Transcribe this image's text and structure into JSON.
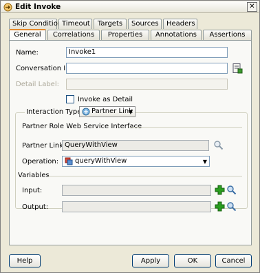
{
  "window": {
    "title": "Edit Invoke",
    "close_symbol": "✕"
  },
  "tabs": {
    "row1": [
      "Skip Condition",
      "Timeout",
      "Targets",
      "Sources",
      "Headers"
    ],
    "row2": [
      "General",
      "Correlations",
      "Properties",
      "Annotations",
      "Assertions"
    ],
    "active": "General"
  },
  "form": {
    "name_label": "Name:",
    "name_value": "Invoke1",
    "conversation_id_label": "Conversation ID:",
    "conversation_id_value": "",
    "detail_label_label": "Detail Label:",
    "detail_label_value": "",
    "invoke_as_detail_label": "Invoke as Detail",
    "invoke_as_detail_checked": false
  },
  "interaction": {
    "label": "Interaction Type:",
    "value": "Partner Link",
    "section_title": "Partner Role Web Service Interface",
    "partner_link_label": "Partner Link:",
    "partner_link_value": "QueryWithView",
    "operation_label": "Operation:",
    "operation_value": "queryWithView",
    "variables_title": "Variables",
    "input_label": "Input:",
    "input_value": "",
    "output_label": "Output:",
    "output_value": ""
  },
  "buttons": {
    "help": "Help",
    "apply": "Apply",
    "ok": "OK",
    "cancel": "Cancel"
  },
  "colors": {
    "active_tab_accent": "#e68b2c",
    "add_icon_green": "#2a9d1f",
    "window_bg": "#ece9d8"
  },
  "icons": [
    "invoke-icon",
    "close-icon",
    "expression-builder-icon",
    "partner-link-icon",
    "chevron-down-icon",
    "search-icon",
    "operation-icon",
    "add-icon"
  ]
}
